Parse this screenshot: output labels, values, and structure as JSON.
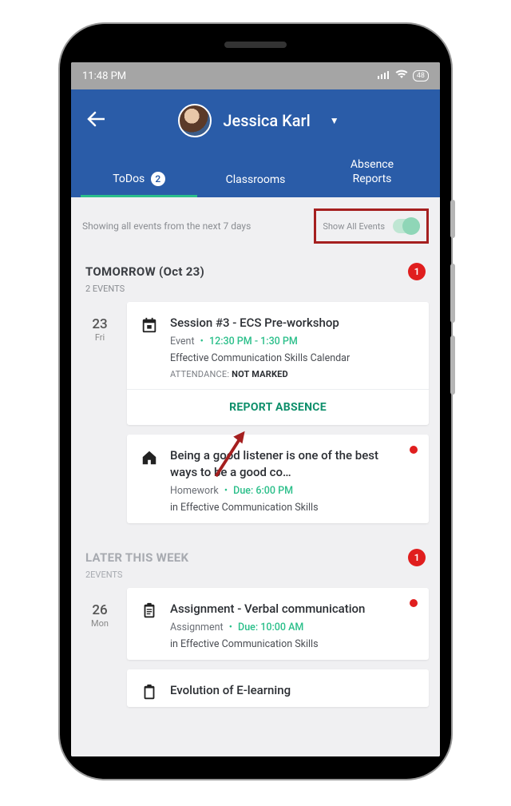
{
  "status": {
    "time": "11:48 PM",
    "battery": "48"
  },
  "header": {
    "profile_name": "Jessica Karl",
    "tabs": {
      "todos": {
        "label": "ToDos",
        "badge": "2"
      },
      "classrooms": {
        "label": "Classrooms"
      },
      "absence": {
        "label": "Absence Reports"
      }
    }
  },
  "filter": {
    "summary": "Showing all events from the next 7 days",
    "toggle_label": "Show All Events"
  },
  "sections": [
    {
      "title": "TOMORROW (Oct 23)",
      "subtitle": "2 EVENTS",
      "badge": "1",
      "day": {
        "num": "23",
        "name": "Fri"
      },
      "cards": [
        {
          "icon": "calendar",
          "title": "Session #3 - ECS Pre-workshop",
          "type": "Event",
          "time": "12:30 PM - 1:30 PM",
          "sub": "Effective Communication Skills Calendar",
          "att_label": "ATTENDANCE:",
          "att_value": "NOT MARKED",
          "action": "REPORT ABSENCE"
        },
        {
          "icon": "home",
          "title": "Being a good listener is one of the best ways to be a good co…",
          "type": "Homework",
          "due_label": "Due:",
          "time": "6:00 PM",
          "sub": "in Effective Communication Skills",
          "dot": true
        }
      ]
    },
    {
      "title": "LATER THIS WEEK",
      "subtitle": "2EVENTS",
      "badge": "1",
      "day": {
        "num": "26",
        "name": "Mon"
      },
      "cards": [
        {
          "icon": "clipboard",
          "title": "Assignment - Verbal communication",
          "type": "Assignment",
          "due_label": "Due:",
          "time": "10:00 AM",
          "sub": "in Effective Communication Skills",
          "dot": true
        },
        {
          "icon": "clipboard",
          "title": "Evolution of E-learning"
        }
      ]
    }
  ]
}
